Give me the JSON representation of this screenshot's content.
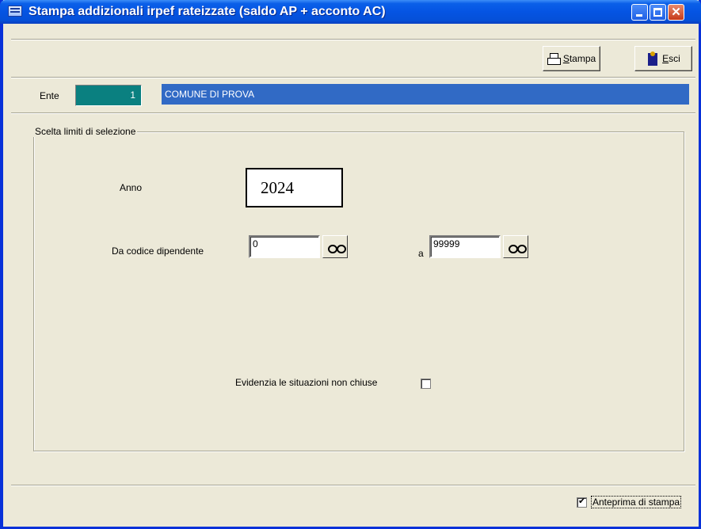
{
  "window": {
    "title": "Stampa addizionali irpef rateizzate (saldo AP + acconto AC)",
    "controls": [
      "minimize",
      "maximize",
      "close"
    ]
  },
  "toolbar": {
    "print_label_mnemonic": "S",
    "print_label_rest": "tampa",
    "exit_label_mnemonic": "E",
    "exit_label_rest": "sci",
    "print_icon": "printer-icon",
    "exit_icon": "exit-door-icon"
  },
  "ente": {
    "label": "Ente",
    "code": "1",
    "name": "COMUNE DI PROVA"
  },
  "selection": {
    "group_title": "Scelta limiti di selezione",
    "anno_label": "Anno",
    "anno_value": "2024",
    "from_label": "Da codice dipendente",
    "from_value": "0",
    "to_label": "a",
    "to_value": "99999",
    "lookup_icon": "glasses-icon"
  },
  "options": {
    "highlight_label": "Evidenzia le situazioni non chiuse",
    "highlight_checked": false,
    "preview_label": "Anteprima di stampa",
    "preview_checked": true
  },
  "colors": {
    "titlebar": "#0554e3",
    "window_bg": "#ece9d8",
    "ente_code_bg": "#0a8080",
    "ente_name_bg": "#316ac5"
  }
}
